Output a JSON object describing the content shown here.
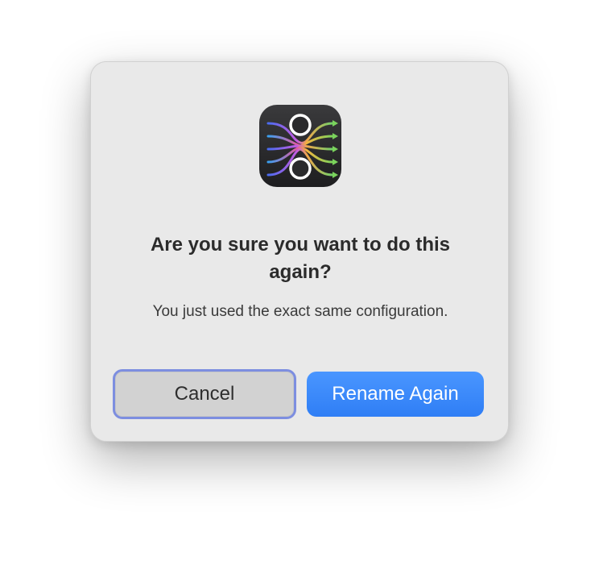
{
  "dialog": {
    "app_icon": "rename-streams-icon",
    "title": "Are you sure you want to do this again?",
    "message": "You just used the exact same configuration.",
    "cancel_label": "Cancel",
    "confirm_label": "Rename Again"
  },
  "colors": {
    "dialog_bg": "#e9e9e9",
    "primary_button": "#3a88fa",
    "cancel_button": "#d2d2d2",
    "focus_ring": "#7d8ee0"
  }
}
